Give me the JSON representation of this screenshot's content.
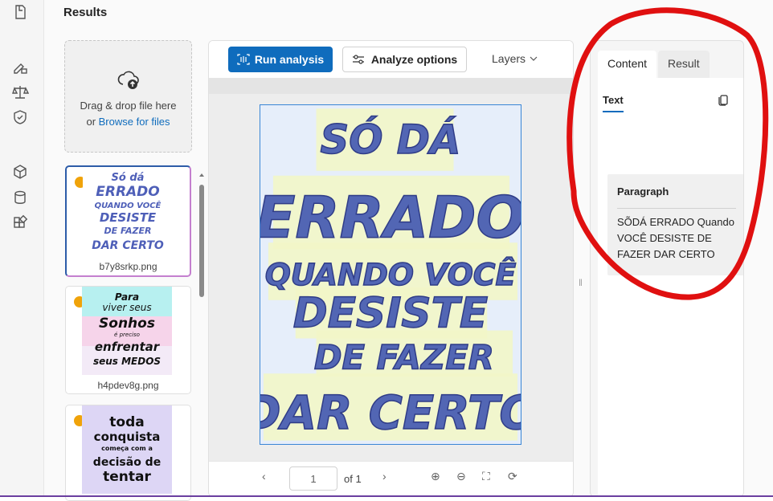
{
  "page": {
    "title": "Results"
  },
  "rail": {
    "icons": [
      "document-icon",
      "pen-edit-icon",
      "scale-icon",
      "shield-icon",
      "cube-icon",
      "database-icon",
      "apps-icon"
    ]
  },
  "upload": {
    "line1": "Drag & drop file here",
    "or": "or ",
    "browse": "Browse for files"
  },
  "files": [
    {
      "name": "b7y8srkp.png",
      "selected": true,
      "status_color": "#f0a30a"
    },
    {
      "name": "h4pdev8g.png",
      "selected": false,
      "status_color": "#f0a30a"
    },
    {
      "name": "",
      "selected": false,
      "status_color": "#f0a30a"
    }
  ],
  "thumbs": {
    "t1": [
      "Só dá",
      "ERRADO",
      "QUANDO VOCÊ",
      "DESISTE",
      "DE FAZER",
      "DAR CERTO"
    ],
    "t2": [
      "Para",
      "viver seus",
      "Sonhos",
      "é preciso",
      "enfrentar",
      "seus MEDOS"
    ],
    "t3": [
      "toda",
      "conquista",
      "começa com a",
      "decisão de",
      "tentar"
    ]
  },
  "toolbar": {
    "run_label": "Run analysis",
    "analyze_label": "Analyze options",
    "layers_label": "Layers"
  },
  "document": {
    "lines": [
      "SÓ DÁ",
      "ERRADO",
      "QUANDO VOCÊ",
      "DESISTE",
      "DE FAZER",
      "DAR CERTO"
    ]
  },
  "pager": {
    "page_value": "1",
    "of_label": "of 1"
  },
  "panel": {
    "tabs": [
      "Content",
      "Result"
    ],
    "subtab": "Text",
    "paragraph_heading": "Paragraph",
    "paragraph_text": "SÕDÁ ERRADO Quando VOCÊ DESISTE DE FAZER DAR CERTO"
  },
  "colors": {
    "accent": "#0f6cbd",
    "annotation": "#e01010",
    "status": "#f0a30a"
  }
}
